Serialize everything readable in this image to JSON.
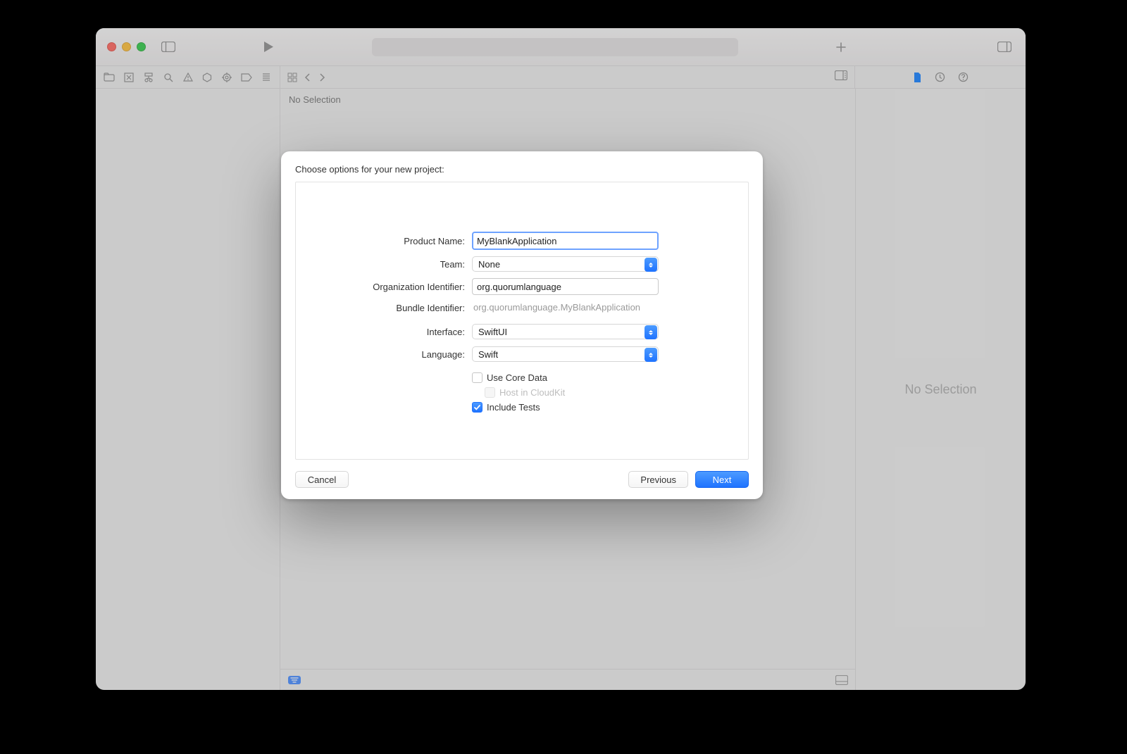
{
  "window": {
    "no_selection_main": "No Selection",
    "no_selection_inspector": "No Selection"
  },
  "dialog": {
    "title": "Choose options for your new project:",
    "fields": {
      "product_name_label": "Product Name:",
      "product_name_value": "MyBlankApplication",
      "team_label": "Team:",
      "team_value": "None",
      "org_id_label": "Organization Identifier:",
      "org_id_value": "org.quorumlanguage",
      "bundle_id_label": "Bundle Identifier:",
      "bundle_id_value": "org.quorumlanguage.MyBlankApplication",
      "interface_label": "Interface:",
      "interface_value": "SwiftUI",
      "language_label": "Language:",
      "language_value": "Swift",
      "use_core_data_label": "Use Core Data",
      "use_core_data_checked": false,
      "host_cloudkit_label": "Host in CloudKit",
      "host_cloudkit_checked": false,
      "host_cloudkit_disabled": true,
      "include_tests_label": "Include Tests",
      "include_tests_checked": true
    },
    "buttons": {
      "cancel": "Cancel",
      "previous": "Previous",
      "next": "Next"
    }
  }
}
